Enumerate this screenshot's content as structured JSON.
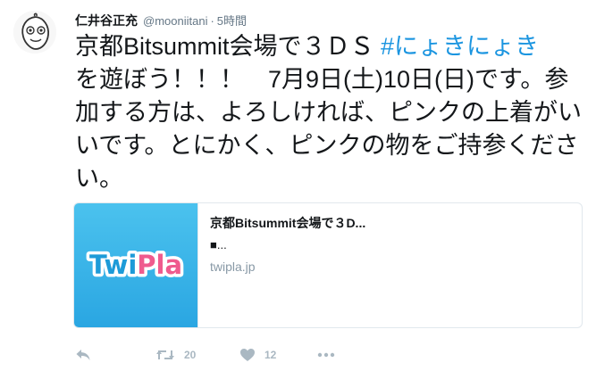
{
  "author": {
    "display_name": "仁井谷正充",
    "handle": "@mooniitani",
    "separator": "·",
    "timestamp": "5時間"
  },
  "tweet": {
    "text_before_hashtag": "京都Bitsummit会場で３ＤＳ ",
    "hashtag": "#にょきにょき",
    "text_after_hashtag": "　を遊ぼう！！！　7月9日(土)10日(日)です。参加する方は、よろしければ、ピンクの上着がいいです。とにかく、ピンクの物をご持参ください。"
  },
  "card": {
    "logo_text_twi": "Twi",
    "logo_text_pla": "Pla",
    "title": "京都Bitsummit会場で３D...",
    "description": "■...",
    "domain": "twipla.jp"
  },
  "actions": {
    "reply_icon": "reply-icon",
    "retweet_icon": "retweet-icon",
    "retweet_count": "20",
    "like_icon": "heart-icon",
    "like_count": "12",
    "more_icon": "more-icon"
  },
  "colors": {
    "hashtag": "#1b95e0",
    "muted": "#657786",
    "action_icon": "#aab8c2",
    "card_bg": "#2aa6e2",
    "logo_twi": "#1d9bd8",
    "logo_pla": "#ef5b8e"
  }
}
